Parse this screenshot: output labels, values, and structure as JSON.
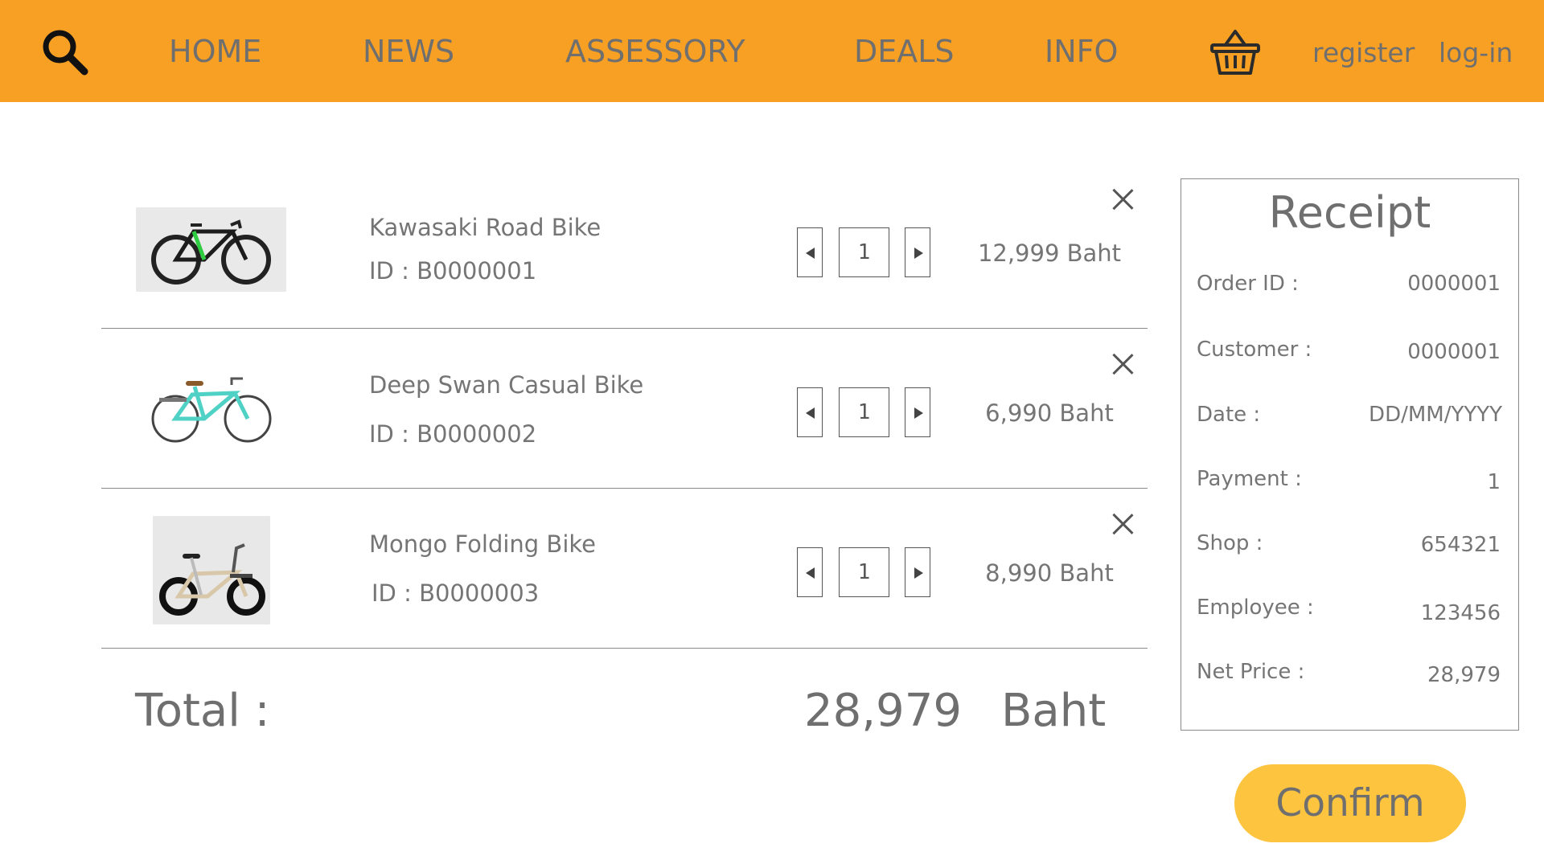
{
  "nav": {
    "search_icon": "magnifier-icon",
    "items": [
      {
        "label": "HOME"
      },
      {
        "label": "NEWS"
      },
      {
        "label": "ASSESSORY"
      },
      {
        "label": "DEALS"
      },
      {
        "label": "INFO"
      }
    ],
    "cart_icon": "basket-icon",
    "register_label": "register",
    "login_label": "log-in"
  },
  "cart": {
    "items": [
      {
        "name": "Kawasaki Road Bike",
        "id_text": "ID : B0000001",
        "qty": "1",
        "price": "12,999 Baht",
        "image": "road-bike-image"
      },
      {
        "name": "Deep Swan Casual Bike",
        "id_text": "ID : B0000002",
        "qty": "1",
        "price": "6,990 Baht",
        "image": "casual-bike-image"
      },
      {
        "name": "Mongo Folding Bike",
        "id_text": "ID : B0000003",
        "qty": "1",
        "price": "8,990 Baht",
        "image": "folding-bike-image"
      }
    ],
    "total_label": "Total :",
    "total_value": "28,979",
    "total_currency": "Baht"
  },
  "receipt": {
    "title": "Receipt",
    "rows": [
      {
        "label": "Order ID :",
        "value": "0000001"
      },
      {
        "label": "Customer :",
        "value": "0000001"
      },
      {
        "label": "Date :",
        "value": "DD/MM/YYYY"
      },
      {
        "label": "Payment :",
        "value": "1"
      },
      {
        "label": "Shop :",
        "value": "654321"
      },
      {
        "label": "Employee :",
        "value": "123456"
      },
      {
        "label": "Net Price :",
        "value": "28,979"
      }
    ]
  },
  "confirm_label": "Confirm",
  "colors": {
    "header": "#f7a024",
    "confirm": "#fcc43f",
    "text": "#757575"
  }
}
